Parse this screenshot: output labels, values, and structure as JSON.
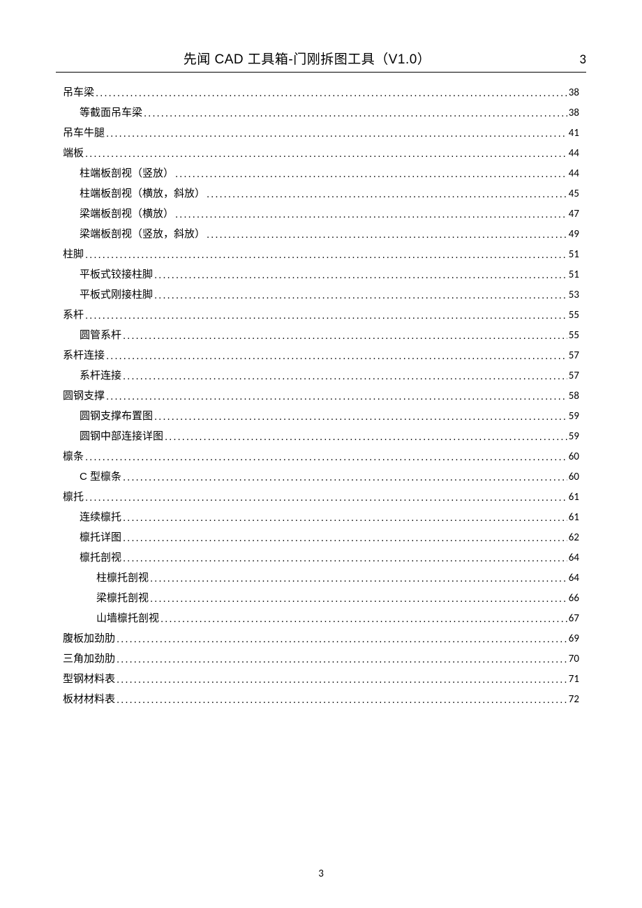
{
  "header": {
    "title": "先闻 CAD 工具箱-门刚拆图工具（V1.0）",
    "page_number": "3"
  },
  "footer": {
    "page_number": "3"
  },
  "toc": [
    {
      "label": "吊车梁",
      "page": "38",
      "level": 0
    },
    {
      "label": "等截面吊车梁",
      "page": "38",
      "level": 1
    },
    {
      "label": "吊车牛腿",
      "page": "41",
      "level": 0
    },
    {
      "label": "端板",
      "page": "44",
      "level": 0
    },
    {
      "label": "柱端板剖视（竖放）",
      "page": "44",
      "level": 1
    },
    {
      "label": "柱端板剖视（横放，斜放）",
      "page": "45",
      "level": 1
    },
    {
      "label": "梁端板剖视（横放）",
      "page": "47",
      "level": 1
    },
    {
      "label": "梁端板剖视（竖放，斜放）",
      "page": "49",
      "level": 1
    },
    {
      "label": "柱脚",
      "page": "51",
      "level": 0
    },
    {
      "label": "平板式铰接柱脚",
      "page": "51",
      "level": 1
    },
    {
      "label": "平板式刚接柱脚",
      "page": "53",
      "level": 1
    },
    {
      "label": "系杆",
      "page": "55",
      "level": 0
    },
    {
      "label": "圆管系杆",
      "page": "55",
      "level": 1
    },
    {
      "label": "系杆连接",
      "page": "57",
      "level": 0
    },
    {
      "label": "系杆连接",
      "page": "57",
      "level": 1
    },
    {
      "label": "圆钢支撑",
      "page": "58",
      "level": 0
    },
    {
      "label": "圆钢支撑布置图",
      "page": "59",
      "level": 1
    },
    {
      "label": "圆钢中部连接详图",
      "page": "59",
      "level": 1
    },
    {
      "label": "檩条",
      "page": "60",
      "level": 0
    },
    {
      "label": "C 型檩条",
      "page": "60",
      "level": 1
    },
    {
      "label": "檩托",
      "page": "61",
      "level": 0
    },
    {
      "label": "连续檩托",
      "page": "61",
      "level": 1
    },
    {
      "label": "檩托详图",
      "page": "62",
      "level": 1
    },
    {
      "label": "檩托剖视",
      "page": "64",
      "level": 1
    },
    {
      "label": "柱檩托剖视",
      "page": "64",
      "level": 2
    },
    {
      "label": "梁檩托剖视",
      "page": "66",
      "level": 2
    },
    {
      "label": "山墙檩托剖视",
      "page": "67",
      "level": 2
    },
    {
      "label": "腹板加劲肋",
      "page": "69",
      "level": 0
    },
    {
      "label": "三角加劲肋",
      "page": "70",
      "level": 0
    },
    {
      "label": "型钢材料表",
      "page": "71",
      "level": 0
    },
    {
      "label": "板材材料表",
      "page": "72",
      "level": 0
    }
  ]
}
